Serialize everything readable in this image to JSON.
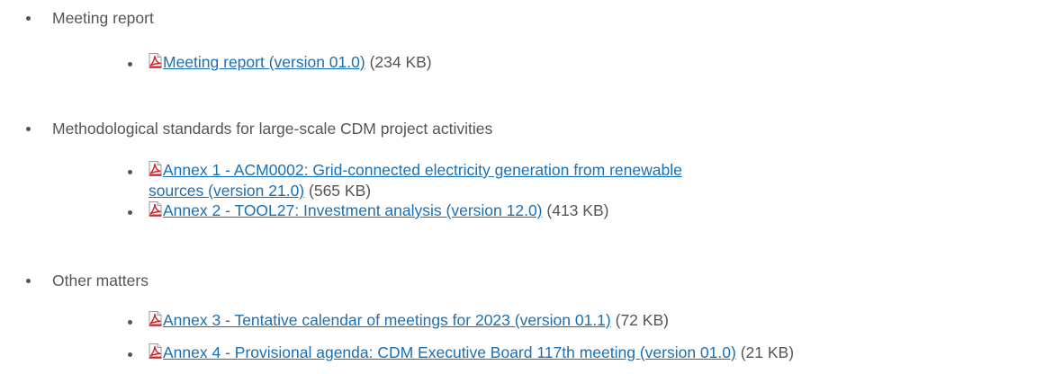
{
  "sections": [
    {
      "title": "Meeting report",
      "items": [
        {
          "link": "Meeting report (version 01.0)",
          "size": "(234 KB)"
        }
      ]
    },
    {
      "title": "Methodological standards for large-scale CDM project activities",
      "items": [
        {
          "link": "Annex 1 - ACM0002: Grid-connected electricity generation from renewable sources (version 21.0)",
          "size": "(565 KB)"
        },
        {
          "link": "Annex 2 - TOOL27: Investment analysis (version 12.0)",
          "size": "(413 KB)"
        }
      ]
    },
    {
      "title": "Other matters",
      "items": [
        {
          "link": "Annex 3 - Tentative calendar of meetings for 2023 (version 01.1)",
          "size": "(72 KB)"
        },
        {
          "link": "Annex 4 - Provisional agenda: CDM Executive Board 117th meeting (version 01.0)",
          "size": "(21 KB)"
        }
      ]
    }
  ],
  "icons": {
    "document": "pdf-file-icon"
  },
  "colors": {
    "text": "#555555",
    "link": "#1a6fb5",
    "pdf_red": "#d2232a"
  }
}
